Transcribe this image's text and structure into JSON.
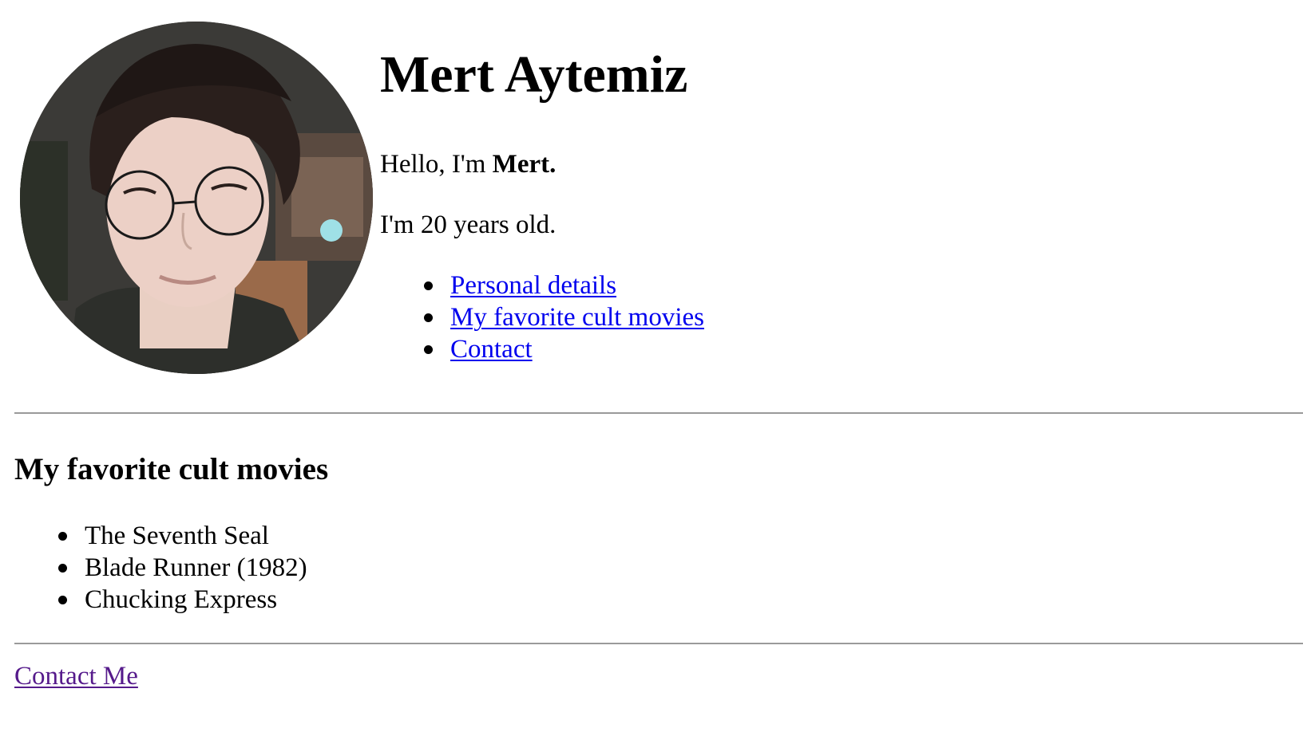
{
  "profile": {
    "name": "Mert Aytemiz",
    "greeting_prefix": "Hello, I'm ",
    "greeting_name": "Mert.",
    "age_text": "I'm 20 years old."
  },
  "nav": {
    "items": [
      {
        "label": "Personal details"
      },
      {
        "label": "My favorite cult movies"
      },
      {
        "label": "Contact"
      }
    ],
    "link_color": "#0000ee"
  },
  "movies": {
    "heading": "My favorite cult movies",
    "items": [
      {
        "title": "The Seventh Seal"
      },
      {
        "title": "Blade Runner (1982)"
      },
      {
        "title": "Chucking Express"
      }
    ]
  },
  "footer": {
    "contact_link": "Contact Me",
    "visited_link_color": "#551a8b"
  }
}
